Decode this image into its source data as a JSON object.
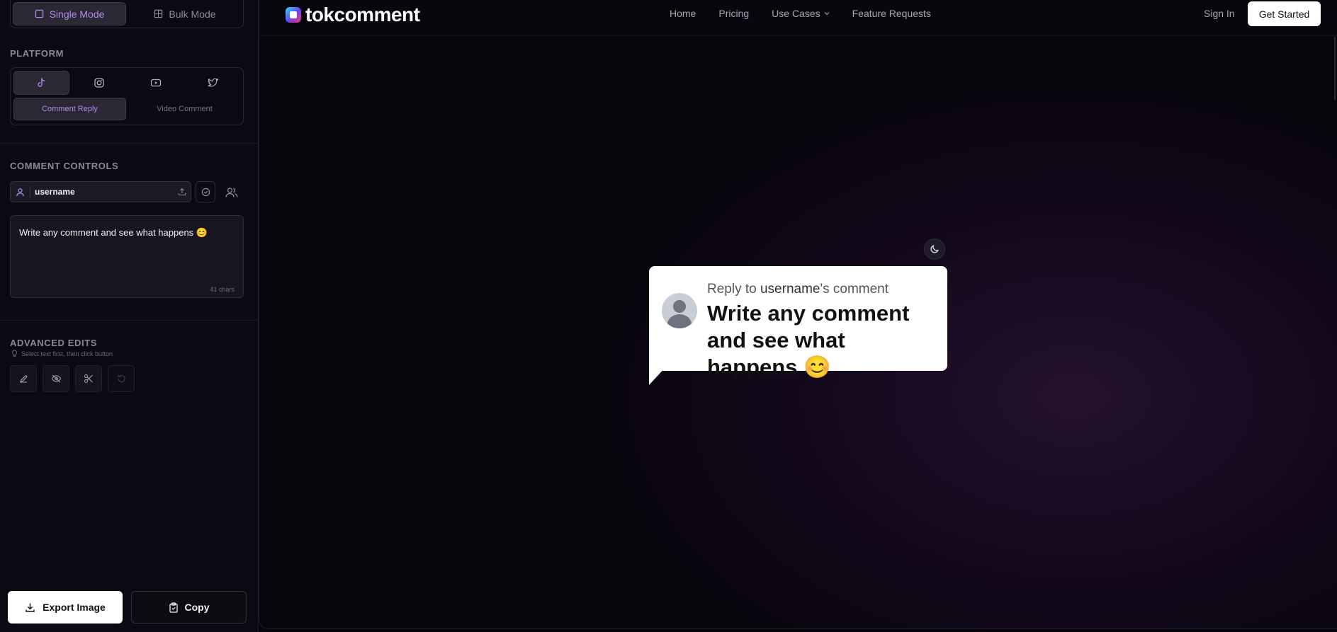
{
  "sidebar": {
    "mode": {
      "single_label": "Single Mode",
      "bulk_label": "Bulk Mode"
    },
    "platform": {
      "title": "PLATFORM",
      "icons": [
        "tiktok-icon",
        "instagram-icon",
        "youtube-icon",
        "twitter-icon"
      ],
      "comment_reply_label": "Comment Reply",
      "video_comment_label": "Video Comment"
    },
    "comment_controls": {
      "title": "COMMENT CONTROLS",
      "username_value": "username",
      "comment_text": "Write any comment and see what happens 😊",
      "char_count": "41 chars"
    },
    "advanced": {
      "title": "ADVANCED EDITS",
      "hint": "Select text first, then click button"
    },
    "export_label": "Export Image",
    "copy_label": "Copy"
  },
  "header": {
    "logo_text": "tokcomment",
    "nav": [
      "Home",
      "Pricing",
      "Use Cases",
      "Feature Requests"
    ],
    "sign_in": "Sign In",
    "get_started": "Get Started"
  },
  "preview": {
    "reply_prefix": "Reply to",
    "reply_user": "username",
    "reply_suffix": "'s comment",
    "comment": "Write any comment and see what happens 😊"
  },
  "colors": {
    "accent": "#b388f0",
    "fab": "#6a5cf0"
  }
}
